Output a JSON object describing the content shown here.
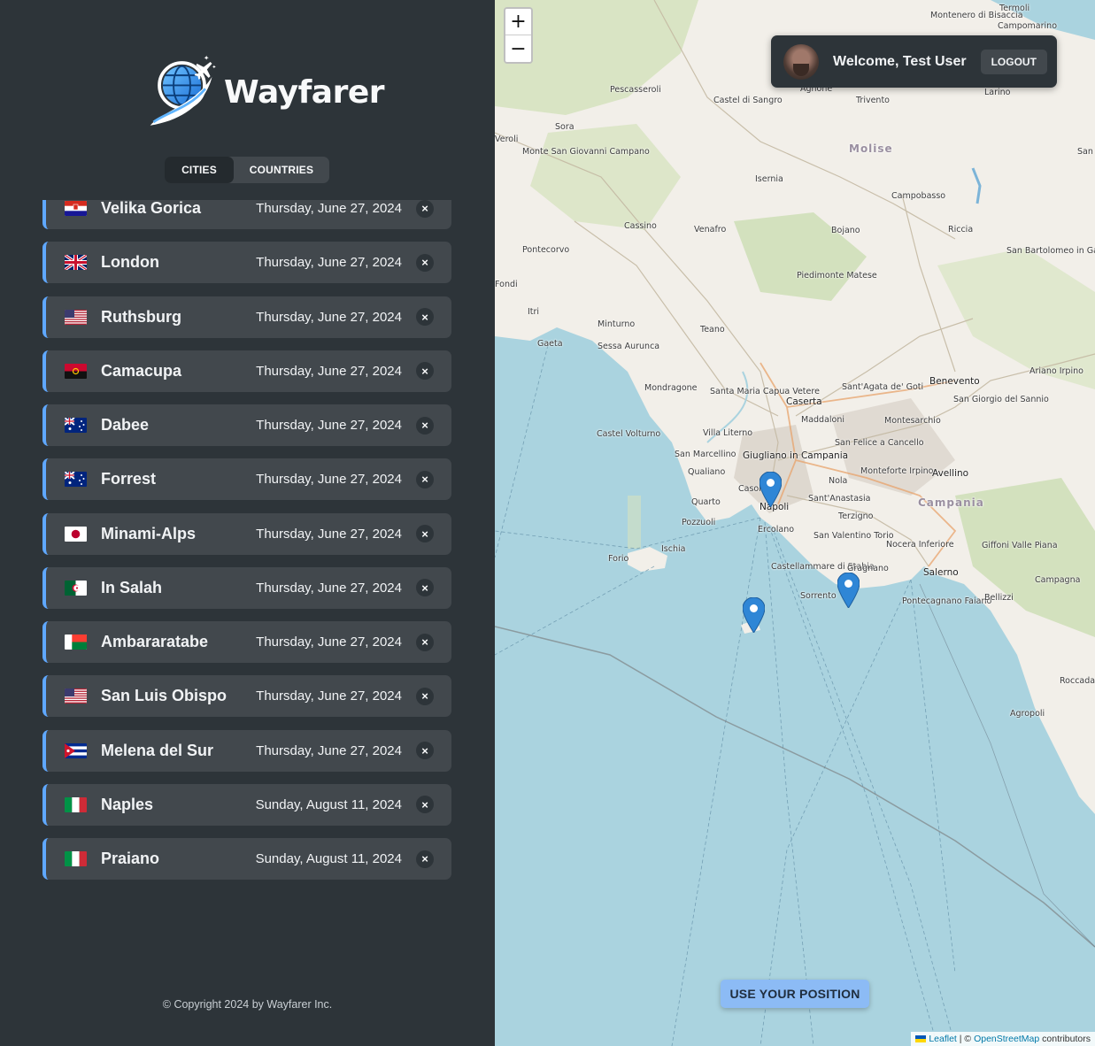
{
  "app": {
    "name": "Wayfarer",
    "footer": "© Copyright 2024 by Wayfarer Inc."
  },
  "tabs": {
    "cities": "CITIES",
    "countries": "COUNTRIES"
  },
  "cities": [
    {
      "name": "Velika Gorica",
      "date": "Thursday, June 27, 2024",
      "flag": "HR"
    },
    {
      "name": "London",
      "date": "Thursday, June 27, 2024",
      "flag": "GB"
    },
    {
      "name": "Ruthsburg",
      "date": "Thursday, June 27, 2024",
      "flag": "US"
    },
    {
      "name": "Camacupa",
      "date": "Thursday, June 27, 2024",
      "flag": "AO"
    },
    {
      "name": "Dabee",
      "date": "Thursday, June 27, 2024",
      "flag": "AU"
    },
    {
      "name": "Forrest",
      "date": "Thursday, June 27, 2024",
      "flag": "AU"
    },
    {
      "name": "Minami-Alps",
      "date": "Thursday, June 27, 2024",
      "flag": "JP"
    },
    {
      "name": "In Salah",
      "date": "Thursday, June 27, 2024",
      "flag": "DZ"
    },
    {
      "name": "Ambararatabe",
      "date": "Thursday, June 27, 2024",
      "flag": "MG"
    },
    {
      "name": "San Luis Obispo",
      "date": "Thursday, June 27, 2024",
      "flag": "US"
    },
    {
      "name": "Melena del Sur",
      "date": "Thursday, June 27, 2024",
      "flag": "CU"
    },
    {
      "name": "Naples",
      "date": "Sunday, August 11, 2024",
      "flag": "IT"
    },
    {
      "name": "Praiano",
      "date": "Sunday, August 11, 2024",
      "flag": "IT"
    }
  ],
  "delete_symbol": "×",
  "map": {
    "zoom_in": "+",
    "zoom_out": "−",
    "user": {
      "welcome": "Welcome, Test User",
      "logout": "LOGOUT"
    },
    "use_position": "USE YOUR POSITION",
    "attribution": {
      "leaflet": "Leaflet",
      "separator": " | © ",
      "osm": "OpenStreetMap",
      "suffix": " contributors"
    },
    "labels": [
      "Termoli",
      "Montenero di Bisaccia",
      "Campomarino",
      "Pescasseroli",
      "Castel di Sangro",
      "Agnone",
      "Trivento",
      "Larino",
      "Sora",
      "Molise",
      "Monte San Giovanni Campano",
      "Veroli",
      "Isernia",
      "Campobasso",
      "Cassino",
      "Venafro",
      "Bojano",
      "Riccia",
      "San Bartolomeo in Galdo",
      "Pontecorvo",
      "Fondi",
      "Piedimonte Matese",
      "Itri",
      "Minturno",
      "Teano",
      "Gaeta",
      "Sessa Aurunca",
      "Ariano Irpino",
      "Mondragone",
      "Santa Maria Capua Vetere",
      "Caserta",
      "Sant'Agata de' Goti",
      "Benevento",
      "San Giorgio del Sannio",
      "Castel Volturno",
      "Villa Literno",
      "Maddaloni",
      "Montesarchio",
      "San Marcellino",
      "Giugliano in Campania",
      "San Felice a Cancello",
      "Qualiano",
      "Casoria",
      "Nola",
      "Monteforte Irpino",
      "Avellino",
      "Quarto",
      "Napoli",
      "Sant'Anastasia",
      "Campania",
      "Pozzuoli",
      "Ercolano",
      "Terzigno",
      "San Valentino Torio",
      "Nocera Inferiore",
      "Forio",
      "Ischia",
      "Castellammare di Stabia",
      "Gragnano",
      "Salerno",
      "Giffoni Valle Piana",
      "Sorrento",
      "Pontecagnano Faiano",
      "Bellizzi",
      "Campagna",
      "Roccadaspide",
      "Agropoli",
      "San"
    ]
  },
  "colors": {
    "sidebar": "#2d3439",
    "item": "#42484d",
    "accent": "#5fa8ff",
    "sea": "#aad3df",
    "land": "#f2efe9"
  }
}
